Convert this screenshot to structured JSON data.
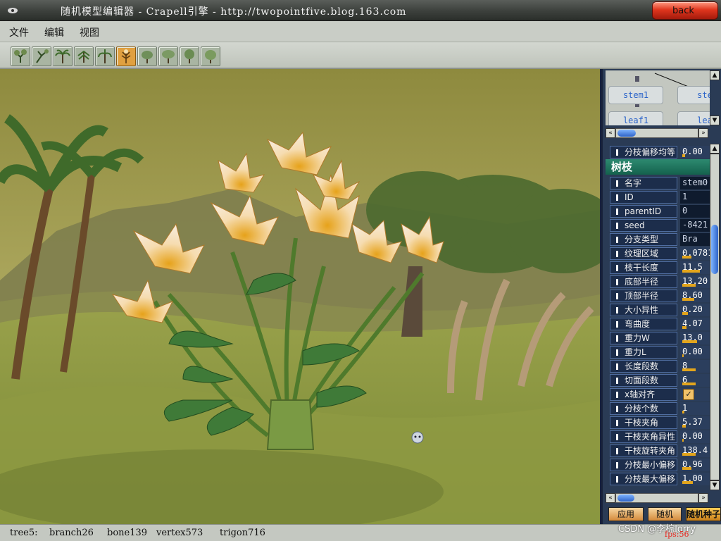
{
  "window": {
    "title": "随机模型编辑器  -  Crapell引擎  -  http://twopointfive.blog.163.com",
    "back_label": "back",
    "app_icon": "app-eye-icon"
  },
  "menu": {
    "items": [
      {
        "label": "文件"
      },
      {
        "label": "编辑"
      },
      {
        "label": "视图"
      }
    ]
  },
  "toolbar": {
    "buttons": [
      {
        "icon": "tree-bush-icon"
      },
      {
        "icon": "tree-branch-icon"
      },
      {
        "icon": "tree-palm-icon"
      },
      {
        "icon": "tree-pine-icon"
      },
      {
        "icon": "tree-palm2-icon"
      },
      {
        "icon": "tree-fern-icon",
        "active": true
      },
      {
        "icon": "tree-shrub-icon"
      },
      {
        "icon": "tree-shrub2-icon"
      },
      {
        "icon": "tree-shrub3-icon"
      },
      {
        "icon": "tree-shrub4-icon"
      }
    ],
    "active_color": "#e0a040"
  },
  "node_graph": {
    "nodes": [
      {
        "label": "stem1"
      },
      {
        "label": "ste"
      },
      {
        "label": "leaf1"
      },
      {
        "label": "lea"
      }
    ]
  },
  "properties": {
    "top_row": {
      "label": "分枝偏移均等",
      "value": "0.00"
    },
    "section_title": "树枝",
    "rows": [
      {
        "label": "名字",
        "value": "stem0"
      },
      {
        "label": "ID",
        "value": "1"
      },
      {
        "label": "parentID",
        "value": "0"
      },
      {
        "label": "seed",
        "value": "-8421"
      },
      {
        "label": "分支类型",
        "value": "Bra"
      },
      {
        "label": "纹理区域",
        "value": "0.0781"
      },
      {
        "label": "枝干长度",
        "value": "11.5"
      },
      {
        "label": "底部半径",
        "value": "13.20"
      },
      {
        "label": "顶部半径",
        "value": "8.60"
      },
      {
        "label": "大小异性",
        "value": "0.20"
      },
      {
        "label": "弯曲度",
        "value": "4.07"
      },
      {
        "label": "重力W",
        "value": "13.0"
      },
      {
        "label": "重力L",
        "value": "0.00"
      },
      {
        "label": "长度段数",
        "value": "8"
      },
      {
        "label": "切面段数",
        "value": "6"
      },
      {
        "label": "x轴对齐",
        "value": "✓"
      },
      {
        "label": "分枝个数",
        "value": "1"
      },
      {
        "label": "干枝夹角",
        "value": "5.37"
      },
      {
        "label": "干枝夹角异性",
        "value": "0.00"
      },
      {
        "label": "干枝旋转夹角",
        "value": "138.4"
      },
      {
        "label": "分枝最小偏移",
        "value": "0.96"
      },
      {
        "label": "分枝最大偏移",
        "value": "1.00"
      }
    ]
  },
  "panel_buttons": {
    "apply": "应用",
    "random": "随机",
    "random_seed": "随机种子"
  },
  "status": {
    "tree": "tree5",
    "branch": "branch26",
    "bone": "bone139",
    "vertex": "vertex573",
    "trigon": "trigon716",
    "fps": "fps:56",
    "watermark": "CSDN @李棕lorry"
  },
  "colors": {
    "accent_orange": "#e0a040",
    "panel_bg": "#2a3b55",
    "section_green": "#14614d",
    "back_red": "#e0361e"
  }
}
